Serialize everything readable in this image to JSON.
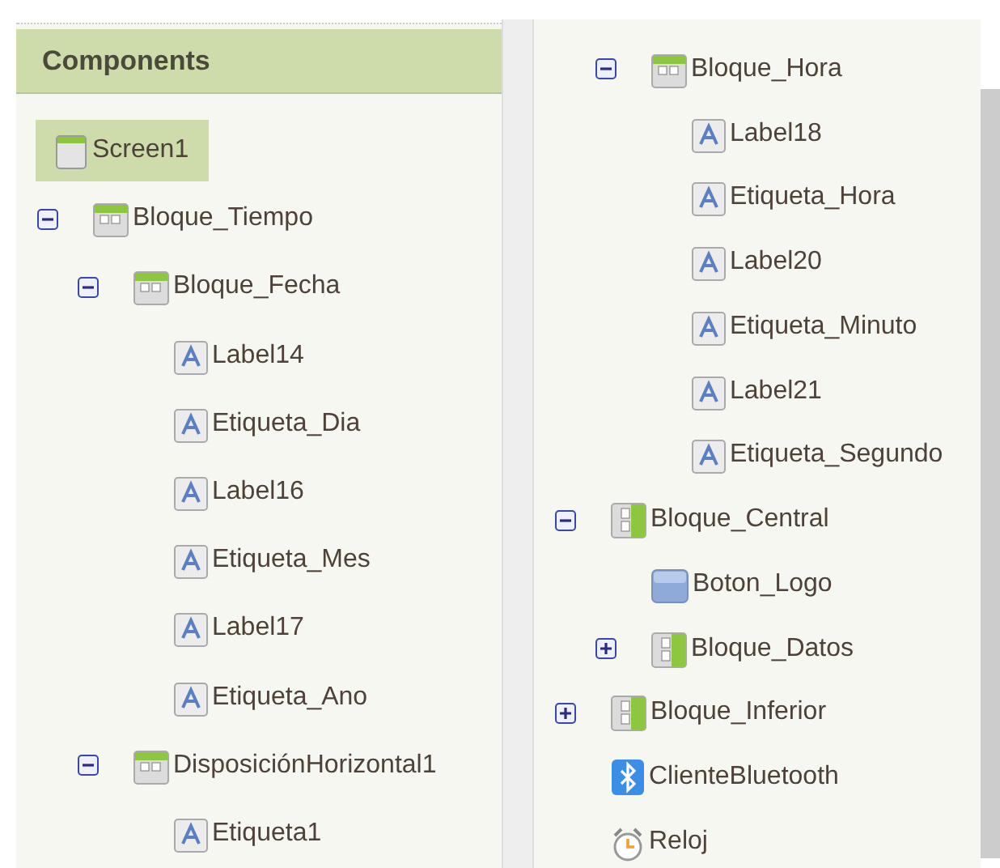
{
  "left_panel": {
    "title": "Components",
    "tree": [
      {
        "label": "Screen1",
        "kind": "screen",
        "selected": true,
        "children": [
          {
            "label": "Bloque_Tiempo",
            "kind": "horizontal",
            "selected": false,
            "expanded": true,
            "children": [
              {
                "label": "Bloque_Fecha",
                "kind": "horizontal",
                "selected": false,
                "expanded": true,
                "children": [
                  {
                    "label": "Label14",
                    "kind": "label",
                    "selected": false
                  },
                  {
                    "label": "Etiqueta_Dia",
                    "kind": "label",
                    "selected": false
                  },
                  {
                    "label": "Label16",
                    "kind": "label",
                    "selected": false
                  },
                  {
                    "label": "Etiqueta_Mes",
                    "kind": "label",
                    "selected": false
                  },
                  {
                    "label": "Label17",
                    "kind": "label",
                    "selected": false
                  },
                  {
                    "label": "Etiqueta_Ano",
                    "kind": "label",
                    "selected": false
                  }
                ]
              },
              {
                "label": "DisposiciónHorizontal1",
                "kind": "horizontal",
                "selected": false,
                "expanded": true,
                "children": [
                  {
                    "label": "Etiqueta1",
                    "kind": "label",
                    "selected": false
                  }
                ]
              }
            ]
          }
        ]
      }
    ]
  },
  "right_panel": {
    "tree": [
      {
        "children": [
          {
            "label": "Bloque_Hora",
            "kind": "horizontal",
            "selected": false,
            "expanded": true,
            "children": [
              {
                "label": "Label18",
                "kind": "label",
                "selected": false
              },
              {
                "label": "Etiqueta_Hora",
                "kind": "label",
                "selected": false
              },
              {
                "label": "Label20",
                "kind": "label",
                "selected": false
              },
              {
                "label": "Etiqueta_Minuto",
                "kind": "label",
                "selected": false
              },
              {
                "label": "Label21",
                "kind": "label",
                "selected": false
              },
              {
                "label": "Etiqueta_Segundo",
                "kind": "label",
                "selected": false
              }
            ]
          }
        ]
      },
      {
        "label": "Bloque_Central",
        "kind": "vertical",
        "selected": false,
        "expanded": true,
        "children": [
          {
            "label": "Boton_Logo",
            "kind": "button",
            "selected": false
          },
          {
            "label": "Bloque_Datos",
            "kind": "vertical",
            "selected": false,
            "expanded": false
          }
        ]
      },
      {
        "label": "Bloque_Inferior",
        "kind": "vertical",
        "selected": false,
        "expanded": false
      },
      {
        "label": "ClienteBluetooth",
        "kind": "bluetooth",
        "selected": false
      },
      {
        "label": "Reloj",
        "kind": "clock",
        "selected": false
      }
    ]
  }
}
